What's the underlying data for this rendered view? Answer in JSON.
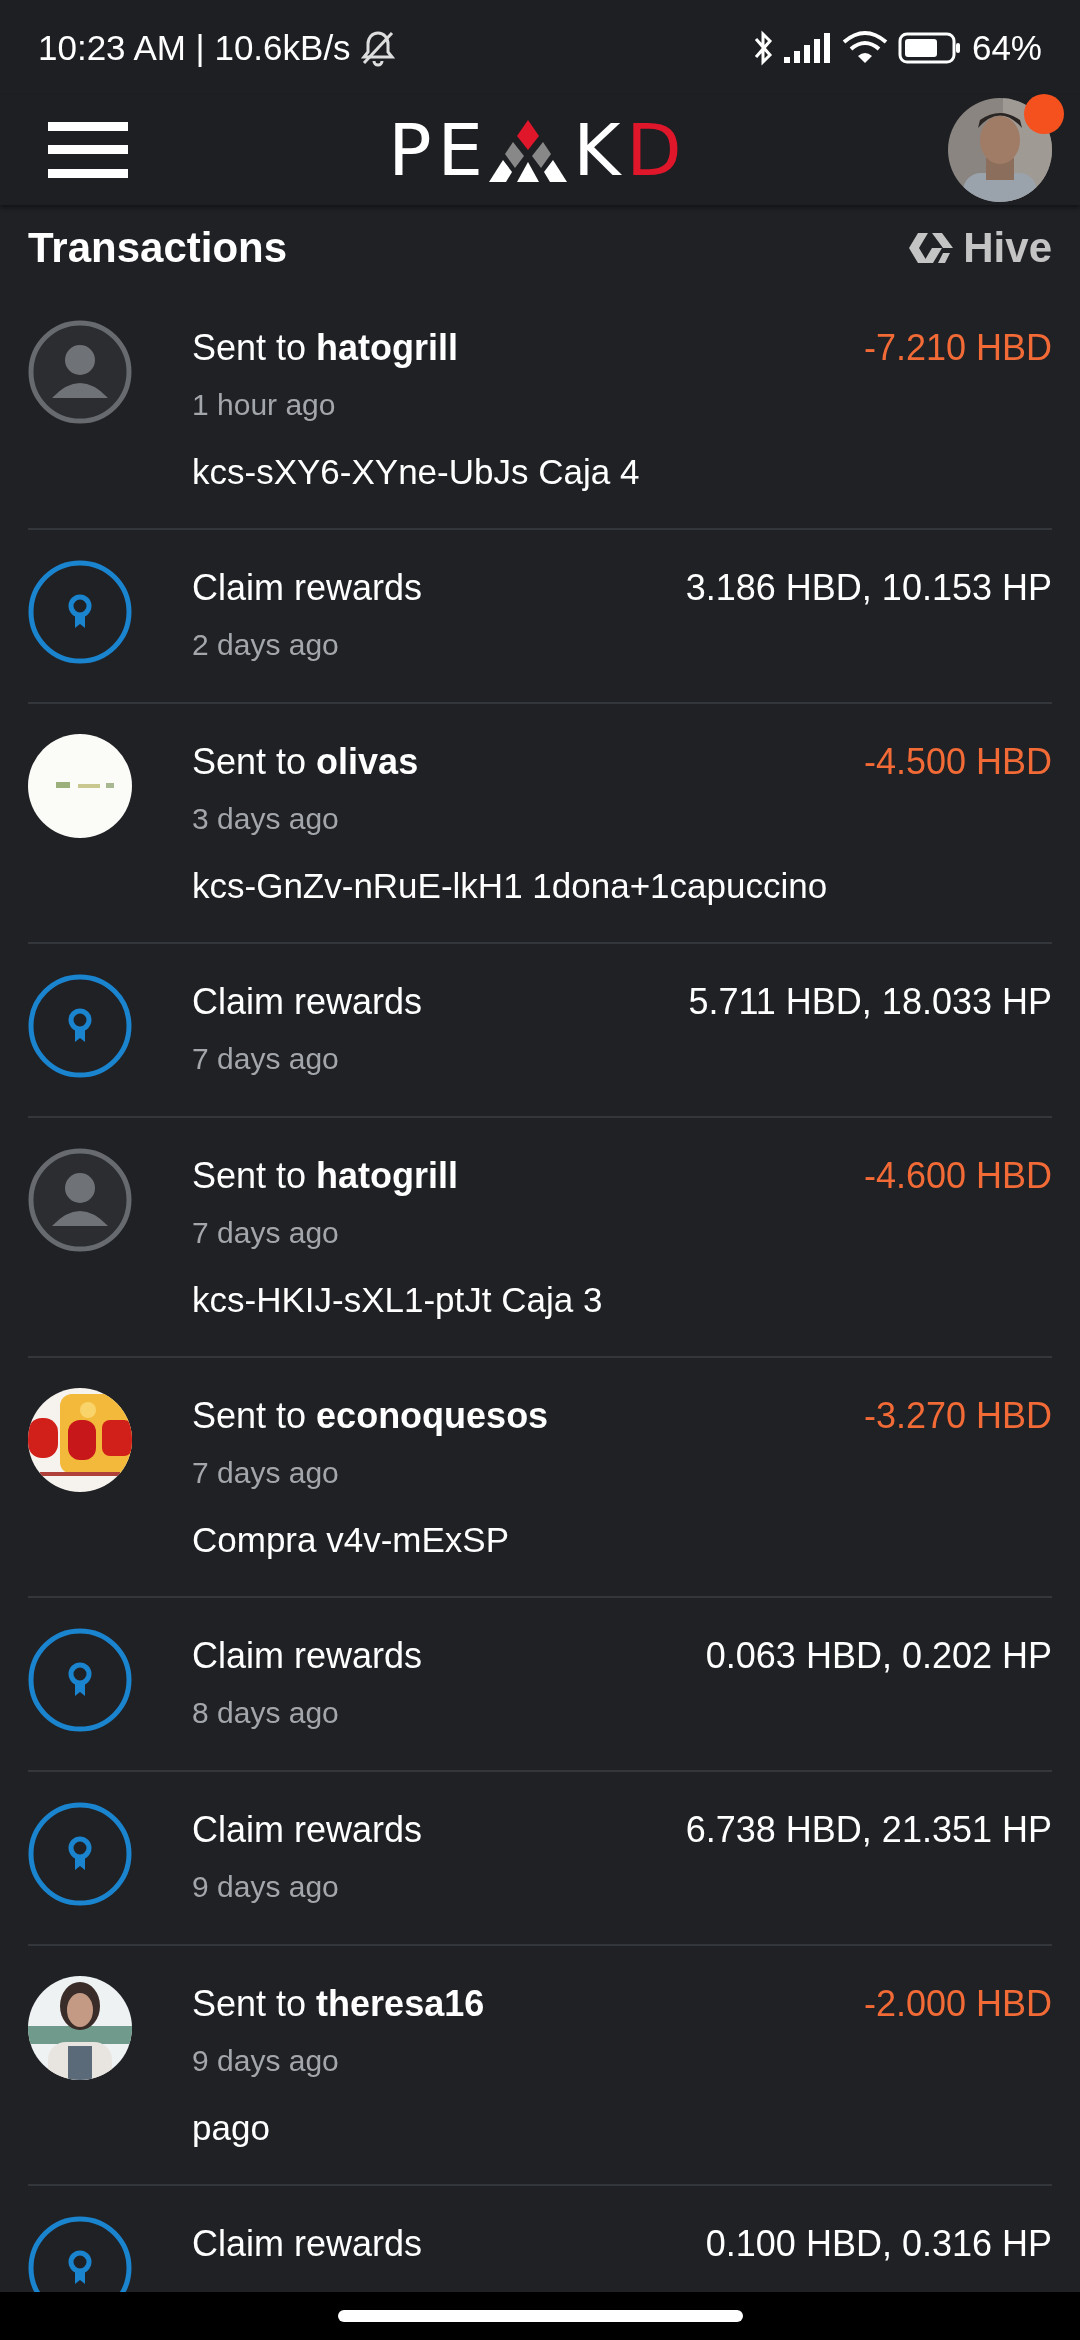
{
  "status_bar": {
    "time": "10:23 AM | 10.6kB/s",
    "battery": "64%"
  },
  "app_bar": {
    "logo": {
      "before": "PE",
      "after": "K",
      "accent": "D"
    },
    "notification_dot": {
      "color": "#f4511e"
    }
  },
  "section": {
    "title": "Transactions",
    "network": "Hive"
  },
  "transactions": [
    {
      "kind": "transfer",
      "avatar": {
        "kind": "default"
      },
      "action": "Sent to",
      "account": "hatogrill",
      "time": "1 hour ago",
      "memo": "kcs-sXY6-XYne-UbJs Caja 4",
      "amount": "-7.210 HBD"
    },
    {
      "kind": "claim",
      "avatar": {
        "kind": "reward"
      },
      "action": "Claim rewards",
      "time": "2 days ago",
      "amount": "3.186 HBD, 10.153 HP"
    },
    {
      "kind": "transfer",
      "action": "Sent to",
      "account": "olivas",
      "time": "3 days ago",
      "memo": "kcs-GnZv-nRuE-lkH1 1dona+1capuccino",
      "amount": "-4.500 HBD"
    },
    {
      "kind": "claim",
      "avatar": {
        "kind": "reward"
      },
      "action": "Claim rewards",
      "time": "7 days ago",
      "amount": "5.711 HBD, 18.033 HP"
    },
    {
      "kind": "transfer",
      "avatar": {
        "kind": "default"
      },
      "action": "Sent to",
      "account": "hatogrill",
      "time": "7 days ago",
      "memo": "kcs-HKIJ-sXL1-ptJt Caja 3",
      "amount": "-4.600 HBD"
    },
    {
      "kind": "transfer",
      "action": "Sent to",
      "account": "econoquesos",
      "time": "7 days ago",
      "memo": "Compra v4v-mExSP",
      "amount": "-3.270 HBD"
    },
    {
      "kind": "claim",
      "avatar": {
        "kind": "reward"
      },
      "action": "Claim rewards",
      "time": "8 days ago",
      "amount": "0.063 HBD, 0.202 HP"
    },
    {
      "kind": "claim",
      "avatar": {
        "kind": "reward"
      },
      "action": "Claim rewards",
      "time": "9 days ago",
      "amount": "6.738 HBD, 21.351 HP"
    },
    {
      "kind": "transfer",
      "action": "Sent to",
      "account": "theresa16",
      "time": "9 days ago",
      "memo": "pago",
      "amount": "-2.000 HBD"
    },
    {
      "kind": "claim",
      "avatar": {
        "kind": "reward"
      },
      "action": "Claim rewards",
      "amount": "0.100 HBD, 0.316 HP"
    }
  ]
}
